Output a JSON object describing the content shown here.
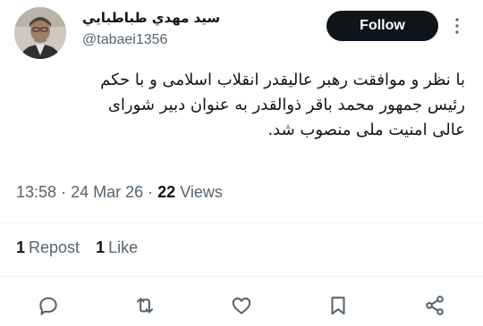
{
  "author": {
    "display_name": "سيد مهدي طباطبايي",
    "handle": "@tabaei1356"
  },
  "follow_button": {
    "label": "Follow"
  },
  "tweet": {
    "text": "با نظر و موافقت رهبر عالیقدر انقلاب اسلامی و با حکم\nرئیس جمهور محمد باقر ذوالقدر به عنوان دبیر شورای\nعالی امنیت ملی منصوب شد."
  },
  "meta": {
    "time": "13:58",
    "separator": "·",
    "date": "24 Mar 26",
    "views_count": "22",
    "views_label": "Views"
  },
  "stats": {
    "reposts_count": "1",
    "reposts_label": "Repost",
    "likes_count": "1",
    "likes_label": "Like"
  },
  "icons": {
    "reply": "reply-icon",
    "repost": "repost-icon",
    "like": "heart-icon",
    "bookmark": "bookmark-icon",
    "share": "share-icon",
    "more": "more-vertical-icon"
  },
  "colors": {
    "text_primary": "#0f1419",
    "text_secondary": "#536471",
    "follow_bg": "#0f1419",
    "divider": "#eff3f4"
  }
}
